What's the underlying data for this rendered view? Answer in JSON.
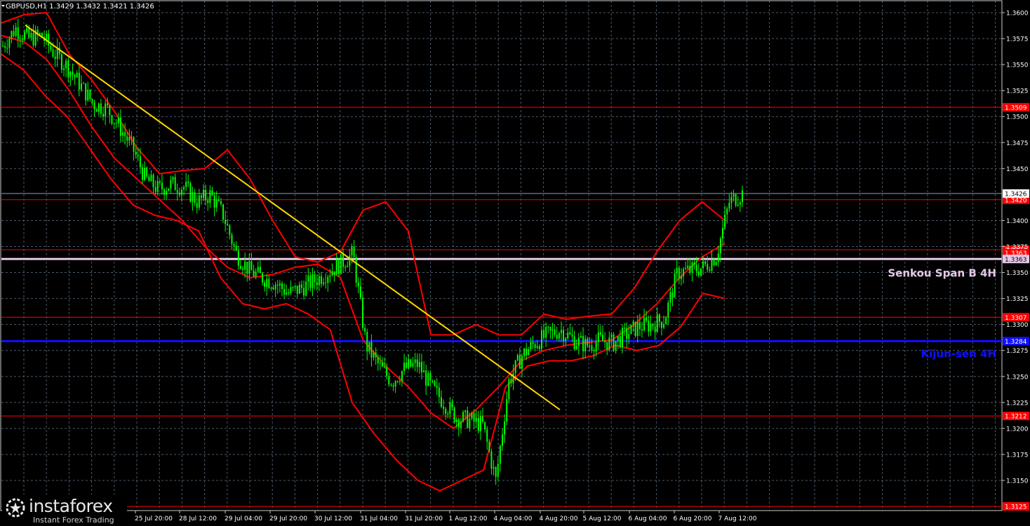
{
  "header": {
    "symbol_text": "GBPUSD,H1  1.3429 1.3432 1.3421 1.3426"
  },
  "logo": {
    "brand": "instaforex",
    "tagline": "Instant Forex Trading",
    "icon": "gear-star-icon"
  },
  "colors": {
    "background": "#000000",
    "grid": "#4a5a6a",
    "candles": "#00ff00",
    "bands": "#ff0000",
    "trendline": "#ffd700",
    "kijun": "#1010ff",
    "senkou": "#e6c8e6",
    "current_price_line": "#8aa0b4",
    "axis_text": "#ffffff"
  },
  "chart_data": {
    "type": "line",
    "title": "GBPUSD,H1",
    "ohlc_header": {
      "open": 1.3429,
      "high": 1.3432,
      "low": 1.3421,
      "close": 1.3426
    },
    "ylim": [
      1.3125,
      1.361
    ],
    "y_ticks": [
      "1.3600",
      "1.3575",
      "1.3550",
      "1.3525",
      "1.3500",
      "1.3475",
      "1.3450",
      "1.3400",
      "1.3375",
      "1.3350",
      "1.3325",
      "1.3300",
      "1.3275",
      "1.3250",
      "1.3225",
      "1.3200",
      "1.3175",
      "1.3150"
    ],
    "x_tick_labels": [
      "25 Jul 20:00",
      "28 Jul 12:00",
      "29 Jul 04:00",
      "29 Jul 20:00",
      "30 Jul 12:00",
      "31 Jul 04:00",
      "31 Jul 20:00",
      "1 Aug 12:00",
      "4 Aug 04:00",
      "4 Aug 20:00",
      "5 Aug 12:00",
      "6 Aug 04:00",
      "6 Aug 20:00",
      "7 Aug 12:00"
    ],
    "grid": true,
    "levels": [
      {
        "name": "",
        "value": 1.3509,
        "label": "1.3509",
        "color": "#ff0000"
      },
      {
        "name": "",
        "value": 1.342,
        "label": "1.3420",
        "color": "#ff0000"
      },
      {
        "name": "",
        "value": 1.3372,
        "label": "1.3372",
        "color": "#ff0000"
      },
      {
        "name": "",
        "value": 1.3363,
        "label": "1.3363",
        "color": "#ff0000"
      },
      {
        "name": "Senkou Span B 4H",
        "value": 1.3363,
        "label": "1.3363",
        "color": "#e6c8e6"
      },
      {
        "name": "",
        "value": 1.3307,
        "label": "1.3307",
        "color": "#ff0000"
      },
      {
        "name": "Kijun-sen 4H",
        "value": 1.3284,
        "label": "1.3284",
        "color": "#1010ff"
      },
      {
        "name": "",
        "value": 1.3212,
        "label": "1.3212",
        "color": "#ff0000"
      },
      {
        "name": "",
        "value": 1.3125,
        "label": "1.3125",
        "color": "#ff0000"
      }
    ],
    "current_price": {
      "value": 1.3426,
      "label": "1.3426"
    },
    "trendline": {
      "from": {
        "x": "24 Jul 14:00",
        "y": 1.3588
      },
      "to": {
        "x": "4 Aug 13:00",
        "y": 1.3218
      }
    },
    "series": [
      {
        "name": "",
        "kind": "price",
        "values": [
          1.3568,
          1.3585,
          1.3575,
          1.3578,
          1.356,
          1.3548,
          1.353,
          1.3512,
          1.3508,
          1.349,
          1.347,
          1.344,
          1.343,
          1.3435,
          1.3432,
          1.3418,
          1.3425,
          1.3405,
          1.3368,
          1.3352,
          1.3345,
          1.334,
          1.333,
          1.3335,
          1.3342,
          1.335,
          1.3358,
          1.3368,
          1.328,
          1.326,
          1.3245,
          1.3258,
          1.3262,
          1.324,
          1.3225,
          1.321,
          1.3208,
          1.3203,
          1.315,
          1.3245,
          1.327,
          1.3282,
          1.329,
          1.3295,
          1.3285,
          1.328,
          1.3285,
          1.3282,
          1.329,
          1.3298,
          1.33,
          1.3305,
          1.335,
          1.3352,
          1.3355,
          1.3366,
          1.3418,
          1.3426
        ]
      },
      {
        "name": "",
        "kind": "upper band",
        "values": [
          1.359,
          1.3598,
          1.36,
          1.356,
          1.3535,
          1.3505,
          1.347,
          1.3445,
          1.3448,
          1.345,
          1.3468,
          1.344,
          1.34,
          1.3365,
          1.336,
          1.337,
          1.341,
          1.3418,
          1.339,
          1.329,
          1.329,
          1.33,
          1.329,
          1.329,
          1.331,
          1.3305,
          1.3308,
          1.331,
          1.3335,
          1.337,
          1.34,
          1.3418,
          1.34
        ]
      },
      {
        "name": "",
        "kind": "lower band",
        "values": [
          1.356,
          1.3545,
          1.352,
          1.35,
          1.347,
          1.344,
          1.3415,
          1.3405,
          1.34,
          1.339,
          1.3345,
          1.332,
          1.3315,
          1.332,
          1.331,
          1.3295,
          1.3225,
          1.3195,
          1.317,
          1.315,
          1.314,
          1.315,
          1.316,
          1.324,
          1.326,
          1.3265,
          1.3265,
          1.327,
          1.328,
          1.3275,
          1.328,
          1.3298,
          1.333,
          1.3325
        ]
      },
      {
        "name": "",
        "kind": "middle line",
        "values": [
          1.3578,
          1.3572,
          1.3555,
          1.3525,
          1.349,
          1.346,
          1.344,
          1.342,
          1.34,
          1.3375,
          1.3355,
          1.3345,
          1.3348,
          1.3355,
          1.3358,
          1.3345,
          1.3285,
          1.326,
          1.324,
          1.3215,
          1.32,
          1.3218,
          1.324,
          1.3265,
          1.3275,
          1.328,
          1.3283,
          1.3285,
          1.33,
          1.332,
          1.3345,
          1.3365,
          1.3378
        ]
      }
    ]
  }
}
